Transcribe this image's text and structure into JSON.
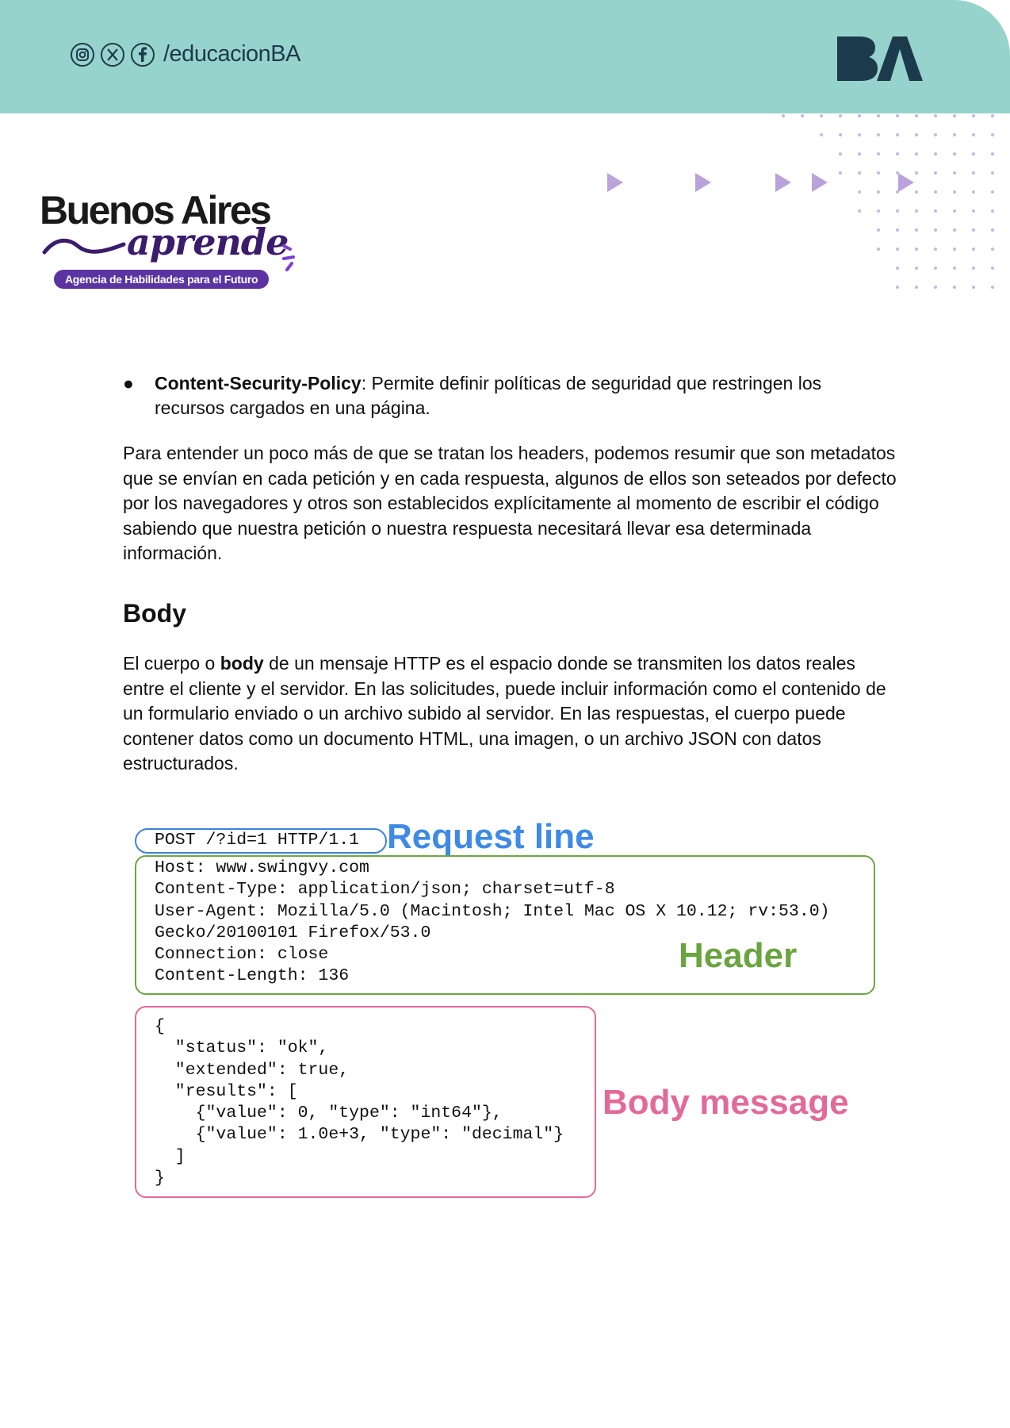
{
  "header": {
    "handle": "/educacionBA",
    "brand": "BA",
    "social_icons": [
      "instagram-icon",
      "x-icon",
      "facebook-icon"
    ],
    "band_color": "#97d3cd"
  },
  "logo": {
    "title": "Buenos Aires",
    "script": "aprende",
    "tagline": "Agencia de Habilidades para el Futuro"
  },
  "bullet": {
    "term": "Content-Security-Policy",
    "text": ": Permite definir políticas de seguridad que restringen los recursos cargados en una página."
  },
  "paragraph1": "Para entender un poco más de que se tratan los headers, podemos resumir que son metadatos que se envían en cada petición y en cada respuesta, algunos de ellos son seteados por defecto por los navegadores y otros son establecidos explícitamente al momento de escribir el código sabiendo que nuestra petición o nuestra respuesta necesitará llevar esa determinada información.",
  "section_title": "Body",
  "paragraph2": {
    "before": "El cuerpo o ",
    "bold": "body",
    "after": " de un mensaje HTTP es el espacio donde se transmiten los datos reales entre el cliente y el servidor. En las solicitudes, puede incluir información como el contenido de un formulario enviado o un archivo subido al servidor. En las respuestas, el cuerpo puede contener datos como un documento HTML, una imagen, o un archivo JSON con datos estructurados."
  },
  "diagram": {
    "request_line": "POST /?id=1 HTTP/1.1",
    "request_label": "Request line",
    "headers": "Host: www.swingvy.com\nContent-Type: application/json; charset=utf-8\nUser-Agent: Mozilla/5.0 (Macintosh; Intel Mac OS X 10.12; rv:53.0)\nGecko/20100101 Firefox/53.0\nConnection: close\nContent-Length: 136",
    "header_label": "Header",
    "body": "{\n  \"status\": \"ok\",\n  \"extended\": true,\n  \"results\": [\n    {\"value\": 0, \"type\": \"int64\"},\n    {\"value\": 1.0e+3, \"type\": \"decimal\"}\n  ]\n}",
    "body_label": "Body message",
    "colors": {
      "request": "#3e8ae6",
      "header": "#6ba43e",
      "body": "#e26a98"
    }
  }
}
